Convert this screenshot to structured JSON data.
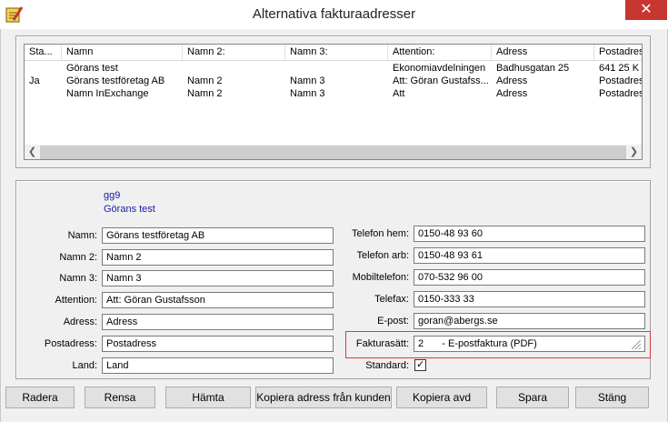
{
  "window": {
    "title": "Alternativa fakturaadresser",
    "close_glyph": "✕"
  },
  "table": {
    "columns": [
      "Sta...",
      "Namn",
      "Namn 2:",
      "Namn 3:",
      "Attention:",
      "Adress",
      "Postadress"
    ],
    "rows": [
      [
        "",
        "Görans test",
        "",
        "",
        "Ekonomiavdelningen",
        "Badhusgatan 25",
        "641 25  K"
      ],
      [
        "Ja",
        "Görans testföretag AB",
        "Namn 2",
        "Namn 3",
        "Att: Göran Gustafss...",
        "Adress",
        "Postadress"
      ],
      [
        "",
        "Namn InExchange",
        "Namn 2",
        "Namn 3",
        "Att",
        "Adress",
        "Postadress"
      ]
    ]
  },
  "info": {
    "code": "gg9",
    "name": "Görans test"
  },
  "form": {
    "left": [
      {
        "label": "Namn:",
        "value": "Görans testföretag AB"
      },
      {
        "label": "Namn 2:",
        "value": "Namn 2"
      },
      {
        "label": "Namn 3:",
        "value": "Namn 3"
      },
      {
        "label": "Attention:",
        "value": "Att: Göran Gustafsson"
      },
      {
        "label": "Adress:",
        "value": "Adress"
      },
      {
        "label": "Postadress:",
        "value": "Postadress"
      },
      {
        "label": "Land:",
        "value": "Land"
      }
    ],
    "right": [
      {
        "label": "Telefon hem:",
        "value": "0150-48 93 60"
      },
      {
        "label": "Telefon arb:",
        "value": "0150-48 93 61"
      },
      {
        "label": "Mobiltelefon:",
        "value": "070-532 96 00"
      },
      {
        "label": "Telefax:",
        "value": "0150-333 33"
      },
      {
        "label": "E-post:",
        "value": "goran@abergs.se"
      }
    ],
    "fakturasatt": {
      "label": "Fakturasätt:",
      "code": "2",
      "text": "- E-postfaktura (PDF)"
    },
    "standard": {
      "label": "Standard:",
      "checked_glyph": "✓"
    }
  },
  "buttons": {
    "radera": "Radera",
    "rensa": "Rensa",
    "hamta": "Hämta",
    "kopiera_kund": "Kopiera adress från kunden",
    "kopiera_avd": "Kopiera avd",
    "spara": "Spara",
    "stang": "Stäng"
  },
  "colors": {
    "close": "#c7372f",
    "highlight": "#d93b3b",
    "info_text": "#1a1aa6"
  }
}
